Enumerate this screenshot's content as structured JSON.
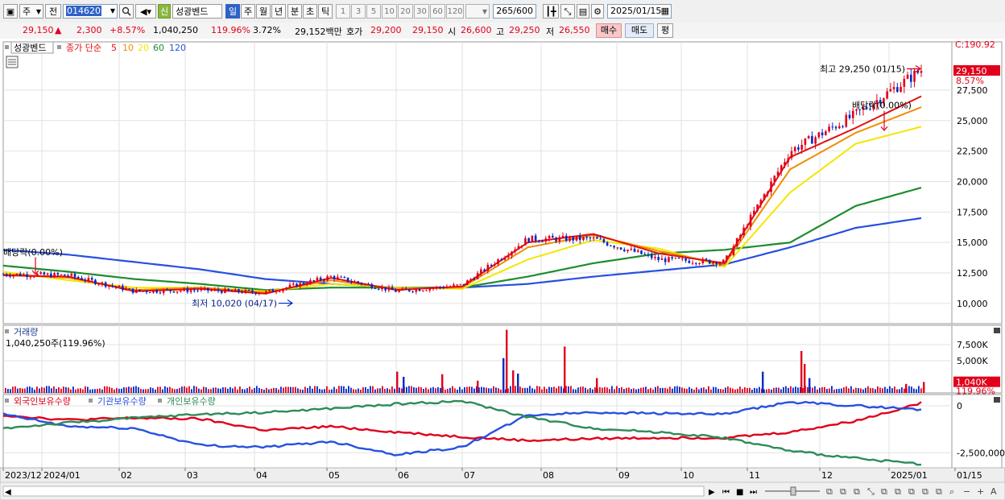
{
  "toolbar": {
    "period_type": "주",
    "prev_label": "전",
    "code": "014620",
    "new_badge": "신",
    "stock_name": "성광벤드",
    "periods": [
      "일",
      "주",
      "월",
      "년",
      "분",
      "초",
      "틱"
    ],
    "selected_period": "일",
    "intervals": [
      "1",
      "3",
      "5",
      "10",
      "20",
      "30",
      "60",
      "120"
    ],
    "count_value": "265",
    "count_total": "/600",
    "date": "2025/01/15"
  },
  "quote": {
    "price": "29,150",
    "arrow": "▲",
    "change": "2,300",
    "change_pct": "+8.57%",
    "volume": "1,040,250",
    "volume_ratio": "119.96%",
    "turnover": "3.72%",
    "amount": "29,152백만",
    "bid_label": "호가",
    "ask": "29,200",
    "bid": "29,150",
    "open_label": "시",
    "open": "26,600",
    "high_label": "고",
    "high": "29,250",
    "low_label": "저",
    "low": "26,550",
    "buy_label": "매수",
    "sell_label": "매도",
    "eval_label": "평"
  },
  "colors": {
    "up": "#e0001b",
    "down": "#0029c8",
    "ma5": "#e01010",
    "ma10": "#f08c00",
    "ma20": "#f4e600",
    "ma60": "#1e8c2c",
    "ma120": "#2850e0",
    "foreign": "#e0001b",
    "institution": "#2850e0",
    "individual": "#2e8b57"
  },
  "price_panel": {
    "name_tag": "성광벤드",
    "legend_label": "종가 단순",
    "ma_periods": [
      "5",
      "10",
      "20",
      "60",
      "120"
    ],
    "ann_high": "최고 29,250 (01/15)",
    "ann_low": "최저 10,020 (04/17)",
    "ann_div1": "배당락(0.00%)",
    "ann_div2": "배당락(0.00%)",
    "axis_top_partial": "C:190.92",
    "last_price_tag": "29,150",
    "last_pct": "8.57%"
  },
  "volume_panel": {
    "title": "거래량",
    "value": "1,040,250주(119.96%)",
    "axis": [
      "7,500K",
      "5,000K"
    ],
    "last_tag": "1,040K",
    "last_pct": "119.96%"
  },
  "holding_panel": {
    "labels": [
      "외국인보유수량",
      "기관보유수량",
      "개인보유수량"
    ],
    "axis": [
      "0",
      "-2,500,000"
    ]
  },
  "x_axis": [
    "2023/12",
    "2024/01",
    "02",
    "03",
    "04",
    "05",
    "06",
    "07",
    "08",
    "09",
    "10",
    "11",
    "12",
    "2025/01",
    "01/15"
  ],
  "chart_data": {
    "type": "line",
    "title": "성광벤드",
    "xlabel": "",
    "ylabel": "",
    "x": [
      "2023/12",
      "2024/01",
      "02",
      "03",
      "04",
      "05",
      "06",
      "07",
      "08",
      "09",
      "10",
      "11",
      "12",
      "2025/01",
      "2025/01/15"
    ],
    "ylim": [
      9000,
      30800
    ],
    "yticks": [
      10000,
      12500,
      15000,
      17500,
      20000,
      22500,
      25000,
      27500
    ],
    "series": [
      {
        "name": "종가",
        "values": [
          12400,
          12300,
          11000,
          11100,
          10900,
          12200,
          11000,
          11500,
          15300,
          15300,
          13600,
          13400,
          22500,
          25500,
          29150
        ]
      },
      {
        "name": "5",
        "values": [
          12300,
          12200,
          11000,
          11200,
          10800,
          12100,
          11100,
          11400,
          15000,
          15700,
          14100,
          13300,
          22000,
          24400,
          27000
        ]
      },
      {
        "name": "10",
        "values": [
          12400,
          12100,
          11100,
          11300,
          10900,
          11900,
          11200,
          11300,
          14600,
          15600,
          14300,
          13200,
          21000,
          24000,
          26100
        ]
      },
      {
        "name": "20",
        "values": [
          12600,
          11900,
          11300,
          11300,
          11000,
          11600,
          11300,
          11200,
          13600,
          15200,
          14500,
          13000,
          19100,
          23100,
          24500
        ]
      },
      {
        "name": "60",
        "values": [
          13100,
          12600,
          12000,
          11600,
          11100,
          11300,
          11300,
          11300,
          12200,
          13300,
          14100,
          14400,
          15000,
          18000,
          19500
        ]
      },
      {
        "name": "120",
        "values": [
          14400,
          14000,
          13400,
          12800,
          12000,
          11600,
          11300,
          11300,
          11600,
          12200,
          12700,
          13200,
          14600,
          16200,
          17000
        ]
      }
    ],
    "volume": {
      "unit": "K",
      "ylim": [
        0,
        10000
      ],
      "yticks": [
        5000,
        7500
      ],
      "last": 1040
    },
    "holdings": {
      "ylim": [
        -3300000,
        600000
      ],
      "yticks": [
        0,
        -2500000
      ],
      "series": [
        {
          "name": "외국인보유수량",
          "values": [
            -500000,
            -750000,
            -650000,
            -700000,
            -1300000,
            -1100000,
            -1400000,
            -1650000,
            -1850000,
            -1750000,
            -1700000,
            -1700000,
            -1400000,
            -800000,
            150000
          ]
        },
        {
          "name": "기관보유수량",
          "values": [
            -450000,
            -1100000,
            -1200000,
            -2100000,
            -2200000,
            -1900000,
            -2600000,
            -2200000,
            -500000,
            -350000,
            -400000,
            -450000,
            200000,
            0,
            -200000
          ]
        },
        {
          "name": "개인보유수량",
          "values": [
            -1200000,
            -900000,
            -650000,
            -450000,
            -350000,
            -150000,
            100000,
            250000,
            -600000,
            -1200000,
            -1400000,
            -1700000,
            -2400000,
            -2800000,
            -3100000
          ]
        }
      ]
    }
  }
}
